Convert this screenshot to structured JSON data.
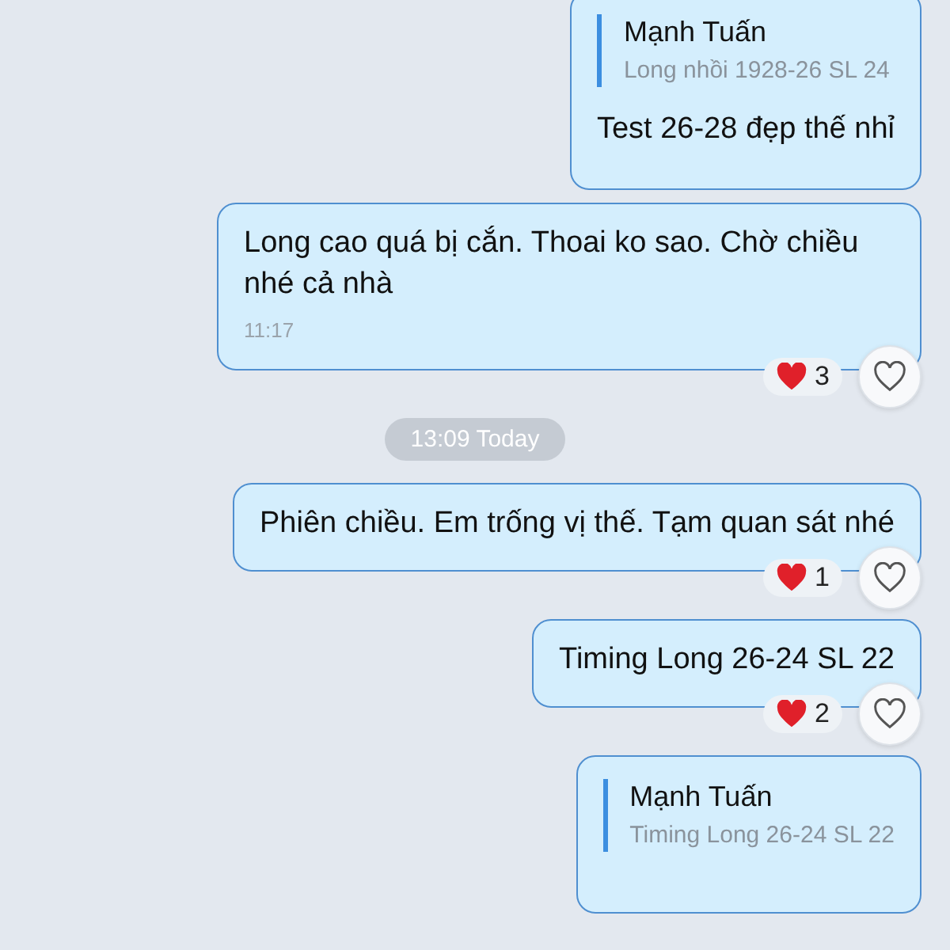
{
  "messages": [
    {
      "kind": "reply",
      "quote": {
        "author": "Mạnh Tuấn",
        "text": "Long nhồi 1928-26 SL 24"
      },
      "text": "Test 26-28 đẹp thế nhỉ"
    },
    {
      "kind": "text",
      "text": "Long cao quá bị cắn. Thoai ko sao. Chờ chiều nhé cả nhà",
      "time": "11:17",
      "reactions": "3"
    },
    {
      "kind": "divider",
      "label": "13:09 Today"
    },
    {
      "kind": "text",
      "text": "Phiên chiều. Em trống vị thế. Tạm quan sát nhé",
      "reactions": "1"
    },
    {
      "kind": "text",
      "text": "Timing Long 26-24 SL 22",
      "reactions": "2"
    },
    {
      "kind": "reply",
      "quote": {
        "author": "Mạnh Tuấn",
        "text": "Timing Long 26-24 SL 22"
      }
    }
  ]
}
